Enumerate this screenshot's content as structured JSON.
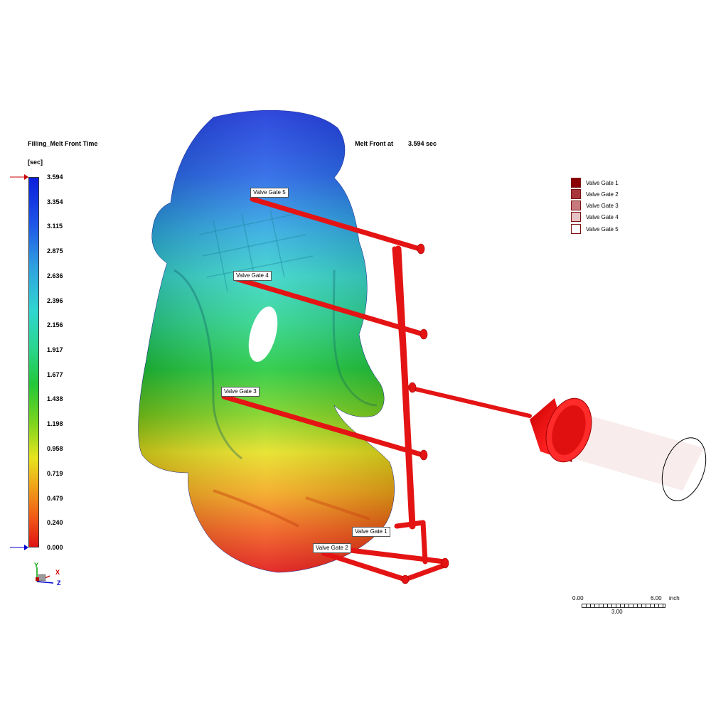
{
  "result_title": "Filling_Melt Front Time",
  "unit": "[sec]",
  "melt_front": {
    "label": "Melt Front at",
    "value": "3.594 sec"
  },
  "color_scale": {
    "ticks": [
      "3.594",
      "3.354",
      "3.115",
      "2.875",
      "2.636",
      "2.396",
      "2.156",
      "1.917",
      "1.677",
      "1.438",
      "1.198",
      "0.958",
      "0.719",
      "0.479",
      "0.240",
      "0.000"
    ],
    "max_marker_color": "#cc0000",
    "min_marker_color": "#0000cc"
  },
  "gate_legend": [
    {
      "label": "Valve Gate 1",
      "color": "#8b0000"
    },
    {
      "label": "Valve Gate 2",
      "color": "#a8353a"
    },
    {
      "label": "Valve Gate 3",
      "color": "#c77a7e"
    },
    {
      "label": "Valve Gate 4",
      "color": "#e6c2c4"
    },
    {
      "label": "Valve Gate 5",
      "color": "#ffffff"
    }
  ],
  "gate_labels": {
    "g1": "Valve Gate 1",
    "g2": "Valve Gate 2",
    "g3": "Valve Gate 3",
    "g4": "Valve Gate 4",
    "g5": "Valve Gate 5"
  },
  "axes": {
    "y": "Y",
    "x": "X",
    "z": "Z"
  },
  "scale_bar": {
    "start": "0.00",
    "mid": "3.00",
    "end": "6.00",
    "unit": "inch"
  }
}
